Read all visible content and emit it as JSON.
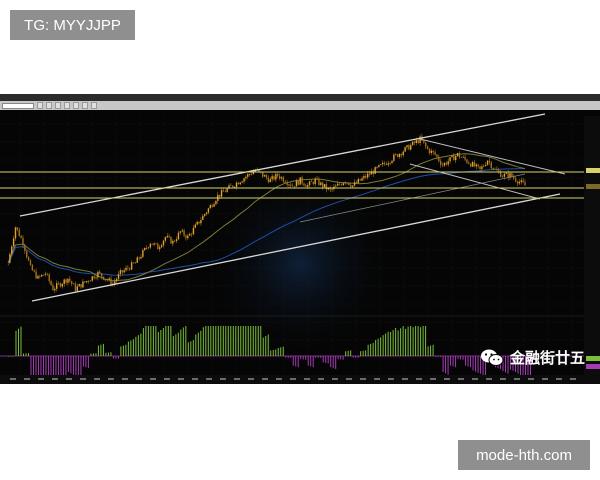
{
  "watermarks": {
    "top_left": "TG: MYYJJPP",
    "bottom_right": "mode-hth.com"
  },
  "wechat": {
    "label": "金融街廿五",
    "icon": "wechat-icon"
  },
  "colors": {
    "background": "#050505",
    "candles": "#e0a22a",
    "channel_lines": "#d8d8d8",
    "horizontal_levels": "#d8d26a",
    "moving_average_1": "#1f4fa8",
    "moving_average_2": "#7a7a3a",
    "histogram_positive": "#7bbf3a",
    "histogram_negative": "#a53bb5"
  },
  "chart_data": {
    "type": "line",
    "closes": [
      1.13,
      1.2,
      1.17,
      1.12,
      1.1,
      1.11,
      1.08,
      1.09,
      1.1,
      1.08,
      1.09,
      1.1,
      1.11,
      1.1,
      1.09,
      1.11,
      1.12,
      1.13,
      1.15,
      1.17,
      1.16,
      1.18,
      1.17,
      1.19,
      1.18,
      1.2,
      1.22,
      1.24,
      1.26,
      1.27,
      1.28,
      1.29,
      1.3,
      1.31,
      1.3,
      1.29,
      1.3,
      1.29,
      1.28,
      1.29,
      1.28,
      1.29,
      1.28,
      1.27,
      1.28,
      1.29,
      1.28,
      1.29,
      1.3,
      1.31,
      1.32,
      1.33,
      1.34,
      1.35,
      1.36,
      1.37,
      1.35,
      1.34,
      1.32,
      1.33,
      1.34,
      1.33,
      1.32,
      1.31,
      1.33,
      1.31,
      1.3,
      1.3,
      1.29,
      1.28
    ],
    "levels": [
      1.3,
      1.28,
      1.33
    ]
  }
}
